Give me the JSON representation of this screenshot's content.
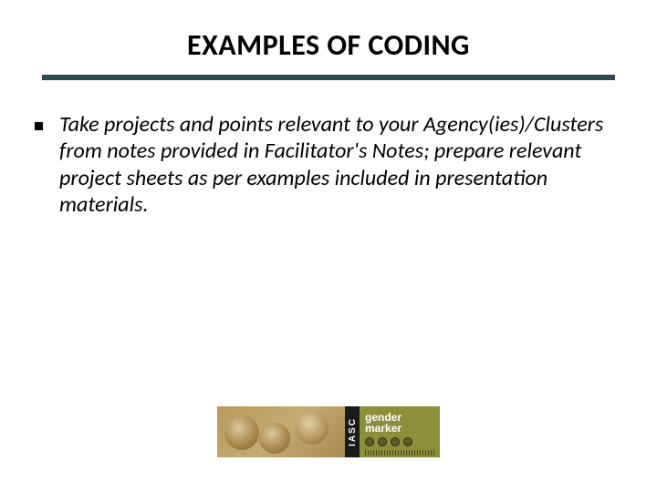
{
  "title": "EXAMPLES OF CODING",
  "bullets": [
    "Take projects and points relevant to your Agency(ies)/Clusters from notes provided in Facilitator's Notes; prepare relevant project sheets as per examples included in presentation materials."
  ],
  "footer": {
    "iasc_label": "IASC",
    "gender_marker_label": "gender marker"
  }
}
